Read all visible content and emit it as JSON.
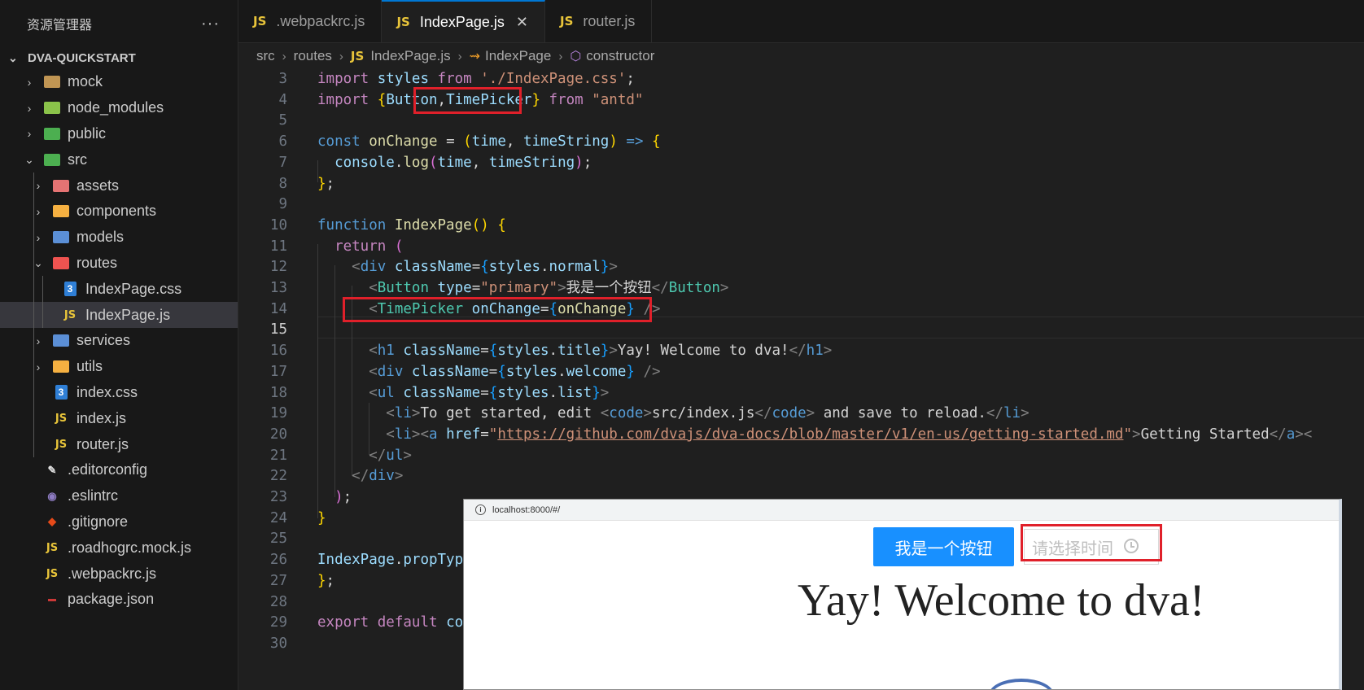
{
  "sidebar": {
    "title": "资源管理器",
    "more": "···",
    "project": "DVA-QUICKSTART",
    "items": [
      {
        "label": "mock",
        "twisty": "›",
        "icon": "folder-icon",
        "color": "#c09553"
      },
      {
        "label": "node_modules",
        "twisty": "›",
        "icon": "node-folder-icon",
        "color": "#8bc34a"
      },
      {
        "label": "public",
        "twisty": "›",
        "icon": "public-folder-icon",
        "color": "#4caf50"
      },
      {
        "label": "src",
        "twisty": "⌄",
        "icon": "src-folder-icon",
        "color": "#4caf50"
      },
      {
        "label": "assets",
        "twisty": "›",
        "icon": "assets-folder-icon",
        "color": "#e57373"
      },
      {
        "label": "components",
        "twisty": "›",
        "icon": "components-folder-icon",
        "color": "#f5b041"
      },
      {
        "label": "models",
        "twisty": "›",
        "icon": "models-folder-icon",
        "color": "#5b8fd6"
      },
      {
        "label": "routes",
        "twisty": "⌄",
        "icon": "routes-folder-icon",
        "color": "#ef5350"
      },
      {
        "label": "IndexPage.css",
        "twisty": "",
        "icon": "css-file-icon"
      },
      {
        "label": "IndexPage.js",
        "twisty": "",
        "icon": "js-file-icon"
      },
      {
        "label": "services",
        "twisty": "›",
        "icon": "services-folder-icon",
        "color": "#5b8fd6"
      },
      {
        "label": "utils",
        "twisty": "›",
        "icon": "utils-folder-icon",
        "color": "#f5b041"
      },
      {
        "label": "index.css",
        "twisty": "",
        "icon": "css-file-icon"
      },
      {
        "label": "index.js",
        "twisty": "",
        "icon": "js-file-icon"
      },
      {
        "label": "router.js",
        "twisty": "",
        "icon": "js-file-icon"
      },
      {
        "label": ".editorconfig",
        "twisty": "",
        "icon": "editorconfig-icon"
      },
      {
        "label": ".eslintrc",
        "twisty": "",
        "icon": "eslint-icon"
      },
      {
        "label": ".gitignore",
        "twisty": "",
        "icon": "git-icon"
      },
      {
        "label": ".roadhogrc.mock.js",
        "twisty": "",
        "icon": "js-file-icon"
      },
      {
        "label": ".webpackrc.js",
        "twisty": "",
        "icon": "js-file-icon"
      },
      {
        "label": "package.json",
        "twisty": "",
        "icon": "npm-icon"
      }
    ],
    "js_badge": "JS",
    "css_badge": "3"
  },
  "tabs": [
    {
      "label": ".webpackrc.js",
      "badge": "JS",
      "active": false
    },
    {
      "label": "IndexPage.js",
      "badge": "JS",
      "active": true,
      "close": "✕"
    },
    {
      "label": "router.js",
      "badge": "JS",
      "active": false
    }
  ],
  "breadcrumb": {
    "parts": [
      "src",
      "routes",
      "IndexPage.js",
      "IndexPage",
      "constructor"
    ],
    "badge": "JS",
    "sep": "›"
  },
  "editor": {
    "line_numbers": [
      "3",
      "4",
      "5",
      "6",
      "7",
      "8",
      "9",
      "10",
      "11",
      "12",
      "13",
      "14",
      "15",
      "16",
      "17",
      "18",
      "19",
      "20",
      "21",
      "22",
      "23",
      "24",
      "25",
      "26",
      "27",
      "28",
      "29",
      "30"
    ],
    "current_line": "15"
  },
  "browser": {
    "url": "localhost:8000/#/",
    "info_icon": "i",
    "button_label": "我是一个按钮",
    "picker_placeholder": "请选择时间",
    "title": "Yay! Welcome to dva!"
  }
}
